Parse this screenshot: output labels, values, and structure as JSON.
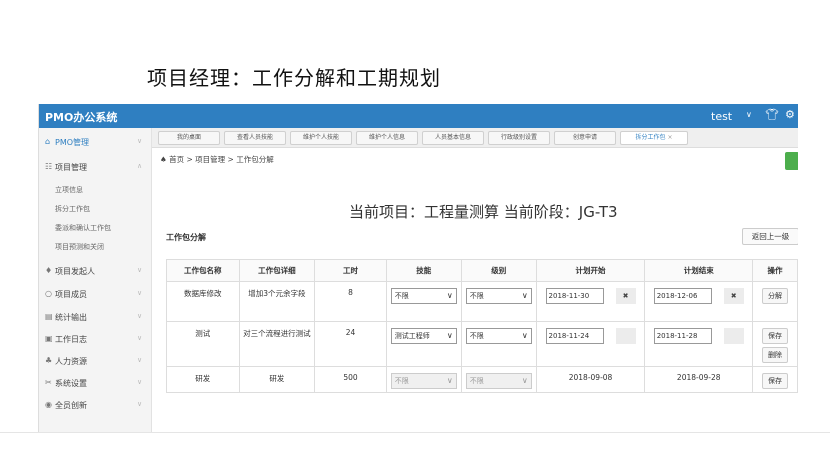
{
  "slide_title": "项目经理：工作分解和工期规划",
  "app": {
    "brand": "PMO办公系统",
    "user": "test",
    "user_caret": "∨",
    "topbar_icons": [
      "shirt-icon",
      "settings-icon"
    ],
    "colors": {
      "topbar": "#2f7fc1",
      "active": "#2f7fc1",
      "green": "#4cae4c"
    }
  },
  "sidebar": {
    "items": [
      {
        "label": "PMO管理",
        "icon": "home-icon",
        "glyph": "⌂",
        "arrow": "∨"
      },
      {
        "label": "项目管理",
        "icon": "grid-icon",
        "glyph": "☷",
        "arrow": "∧"
      },
      {
        "label": "项目发起人",
        "icon": "user-icon",
        "glyph": "♦",
        "arrow": "∨"
      },
      {
        "label": "项目成员",
        "icon": "member-icon",
        "glyph": "○",
        "arrow": "∨"
      },
      {
        "label": "统计输出",
        "icon": "chart-icon",
        "glyph": "▤",
        "arrow": "∨"
      },
      {
        "label": "工作日志",
        "icon": "log-icon",
        "glyph": "▣",
        "arrow": "∨"
      },
      {
        "label": "人力资源",
        "icon": "people-icon",
        "glyph": "♣",
        "arrow": "∨"
      },
      {
        "label": "系统设置",
        "icon": "wrench-icon",
        "glyph": "✂",
        "arrow": "∨"
      },
      {
        "label": "全员创新",
        "icon": "bulb-icon",
        "glyph": "◉",
        "arrow": "∨"
      }
    ],
    "sub_items": [
      "立项信息",
      "拆分工作包",
      "委派和确认工作包",
      "项目预测和关闭"
    ]
  },
  "tabs": [
    "我的桌面",
    "查看人员技能",
    "维护个人技能",
    "维护个人信息",
    "人员基本信息",
    "行政级别设置",
    "创意申请",
    "拆分工作包"
  ],
  "tab_close": "×",
  "breadcrumb": "♠ 首页 > 项目管理 > 工作包分解",
  "current_project": "当前项目：工程量测算  当前阶段：JG-T3",
  "section_title": "工作包分解",
  "back_button": "返回上一级",
  "table": {
    "headers": [
      "工作包名称",
      "工作包详细",
      "工时",
      "技能",
      "级别",
      "计划开始",
      "计划结束",
      "操作"
    ],
    "rows": [
      {
        "name": "数据库修改",
        "detail": "增加3个元余字段",
        "hours": "8",
        "skill": "不限",
        "level": "不限",
        "start": "2018-11-30",
        "start_clear": "✖",
        "end": "2018-12-06",
        "end_clear": "✖",
        "actions": [
          "分解"
        ]
      },
      {
        "name": "测试",
        "detail": "对三个流程进行测试",
        "hours": "24",
        "skill": "测试工程师",
        "level": "不限",
        "start": "2018-11-24",
        "start_clear": "",
        "end": "2018-11-28",
        "end_clear": "",
        "actions": [
          "保存",
          "删除"
        ]
      },
      {
        "name": "研发",
        "detail": "研发",
        "hours": "500",
        "skill": "不限",
        "level": "不限",
        "start": "2018-09-08",
        "end": "2018-09-28",
        "actions": [
          "保存"
        ]
      }
    ],
    "caret": "∨"
  }
}
